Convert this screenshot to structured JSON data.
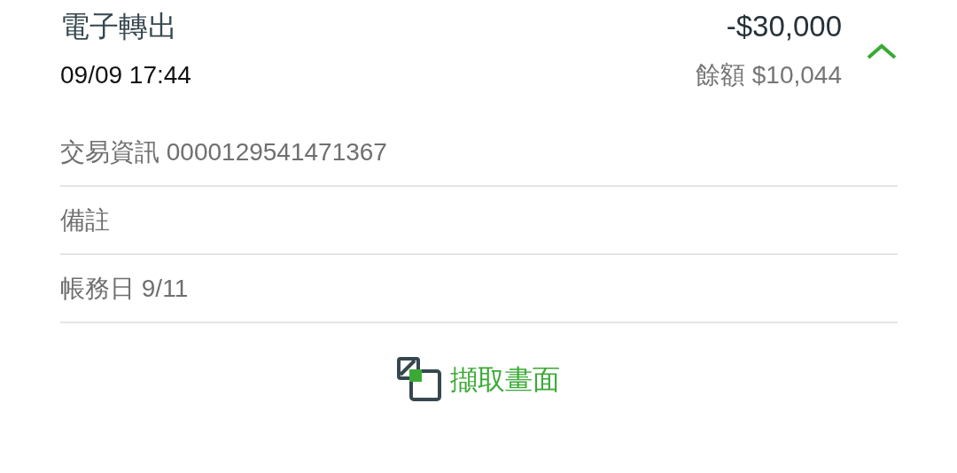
{
  "transaction": {
    "title": "電子轉出",
    "amount": "-$30,000",
    "datetime": "09/09 17:44",
    "balance": "餘額 $10,044",
    "expanded": true
  },
  "details": [
    {
      "text": "交易資訊 0000129541471367"
    },
    {
      "text": "備註"
    },
    {
      "text": "帳務日 9/11"
    }
  ],
  "action": {
    "label": "擷取畫面"
  }
}
